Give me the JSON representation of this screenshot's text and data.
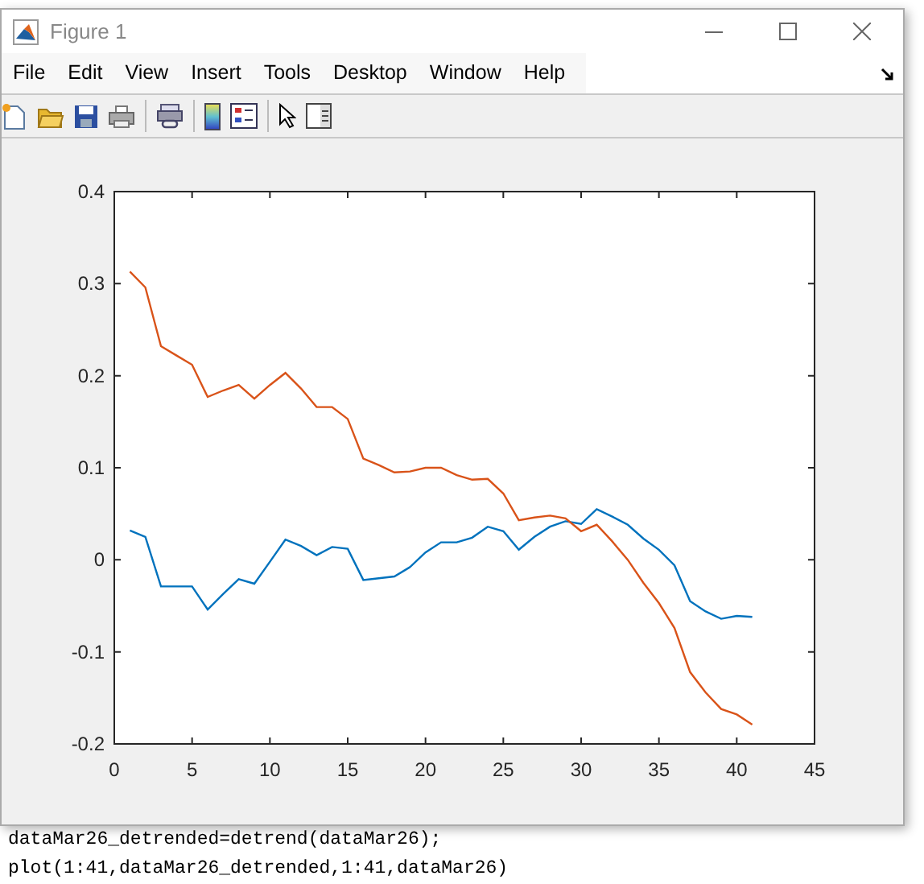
{
  "window": {
    "title": "Figure 1"
  },
  "menu": [
    "File",
    "Edit",
    "View",
    "Insert",
    "Tools",
    "Desktop",
    "Window",
    "Help"
  ],
  "plot": {
    "chart_data": {
      "type": "line",
      "x": [
        1,
        2,
        3,
        4,
        5,
        6,
        7,
        8,
        9,
        10,
        11,
        12,
        13,
        14,
        15,
        16,
        17,
        18,
        19,
        20,
        21,
        22,
        23,
        24,
        25,
        26,
        27,
        28,
        29,
        30,
        31,
        32,
        33,
        34,
        35,
        36,
        37,
        38,
        39,
        40,
        41
      ],
      "xlim": [
        0,
        45
      ],
      "ylim": [
        -0.2,
        0.4
      ],
      "xticks": [
        0,
        5,
        10,
        15,
        20,
        25,
        30,
        35,
        40,
        45
      ],
      "yticks": [
        {
          "value": -0.2,
          "label": "-0.2"
        },
        {
          "value": -0.1,
          "label": "-0.1"
        },
        {
          "value": 0,
          "label": "0"
        },
        {
          "value": 0.1,
          "label": "0.1"
        },
        {
          "value": 0.2,
          "label": "0.2"
        },
        {
          "value": 0.3,
          "label": "0.3"
        },
        {
          "value": 0.4,
          "label": "0.4"
        }
      ],
      "series": [
        {
          "color": "#0072bd",
          "values": [
            0.032,
            0.025,
            -0.029,
            -0.029,
            -0.029,
            -0.054,
            -0.037,
            -0.021,
            -0.026,
            -0.002,
            0.022,
            0.015,
            0.005,
            0.014,
            0.012,
            -0.022,
            -0.02,
            -0.018,
            -0.008,
            0.008,
            0.019,
            0.019,
            0.024,
            0.036,
            0.031,
            0.011,
            0.025,
            0.036,
            0.042,
            0.039,
            0.055,
            0.047,
            0.038,
            0.023,
            0.011,
            -0.006,
            -0.045,
            -0.056,
            -0.064,
            -0.061,
            -0.062
          ]
        },
        {
          "color": "#d95319",
          "values": [
            0.313,
            0.296,
            0.232,
            0.222,
            0.212,
            0.177,
            0.184,
            0.19,
            0.175,
            0.19,
            0.203,
            0.186,
            0.166,
            0.166,
            0.153,
            0.11,
            0.103,
            0.095,
            0.096,
            0.1,
            0.1,
            0.092,
            0.087,
            0.088,
            0.072,
            0.043,
            0.046,
            0.048,
            0.045,
            0.031,
            0.038,
            0.02,
            0.0,
            -0.025,
            -0.047,
            -0.074,
            -0.122,
            -0.144,
            -0.162,
            -0.168,
            -0.179
          ]
        }
      ]
    }
  },
  "code_lines": [
    "dataMar26_detrended=detrend(dataMar26);",
    "plot(1:41,dataMar26_detrended,1:41,dataMar26)"
  ]
}
